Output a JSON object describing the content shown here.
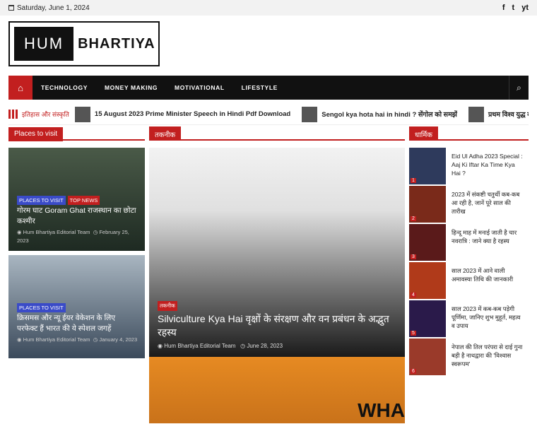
{
  "topbar": {
    "date": "Saturday, June 1, 2024",
    "social": [
      "f",
      "t",
      "yt"
    ]
  },
  "logo": {
    "left": "HUM",
    "right": "BHARTIYA"
  },
  "nav": {
    "home": "⌂",
    "items": [
      "TECHNOLOGY",
      "MONEY MAKING",
      "MOTIVATIONAL",
      "LIFESTYLE"
    ],
    "search": "⌕"
  },
  "ticker": {
    "label": "इतिहास और संस्कृति",
    "items": [
      "15 August 2023 Prime Minister Speech in Hindi Pdf Download",
      "Sengol kya hota hai in hindi ? सेंगोल को समझें",
      "प्रथम विश्व युद्ध कब हुआ और यह कब तक चला"
    ]
  },
  "left": {
    "heading": "Places to visit",
    "cards": [
      {
        "cats": [
          "PLACES TO VISIT",
          "TOP NEWS"
        ],
        "title": "गोरम घाट Goram Ghat राजस्थान का छोटा कश्मीर",
        "author": "Hum Bhartiya Editorial Team",
        "date": "February 25, 2023"
      },
      {
        "cats": [
          "PLACES TO VISIT"
        ],
        "title": "क्रिसमस और न्यू ईयर वेकेशन के लिए परफेक्ट हैं भारत की ये स्पेशल जगहें",
        "author": "Hum Bhartiya Editorial Team",
        "date": "January 4, 2023"
      }
    ]
  },
  "mid": {
    "heading": "तकनीक",
    "main": {
      "cat": "तकनीक",
      "title": "Silviculture Kya Hai वृक्षों के संरक्षण और वन प्रबंधन के अद्भुत रहस्य",
      "author": "Hum Bhartiya Editorial Team",
      "date": "June 28, 2023"
    },
    "second": {
      "text": "WHA"
    }
  },
  "right": {
    "heading": "धार्मिक",
    "items": [
      {
        "n": "1",
        "title": "Eid Ul Adha 2023 Special : Aaj Ki Iftar Ka Time Kya Hai ?"
      },
      {
        "n": "2",
        "title": "2023 में संकष्टी चतुर्थी कब-कब आ रही है, जानें पूरे साल की तारीख"
      },
      {
        "n": "3",
        "title": "हिन्दू माह में मनाई जाती है चार नवरात्रि : जाने क्या है रहस्य"
      },
      {
        "n": "4",
        "title": "साल 2023 में आने वाली अमावस्या तिथि की जानकारी"
      },
      {
        "n": "5",
        "title": "साल 2023 में कब-कब पड़ेगी पूर्णिमा, जानिए शुभ मुहूर्त, महत्व व उपाय"
      },
      {
        "n": "6",
        "title": "नेपाल की तिल परंपरा से दाई गुना बड़ी है नाथद्वारा की 'विश्वास स्वरूपम'"
      }
    ]
  }
}
